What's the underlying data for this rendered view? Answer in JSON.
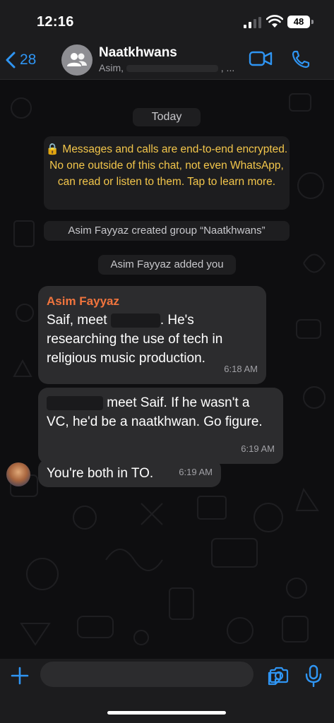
{
  "status_bar": {
    "time": "12:16",
    "battery": "48"
  },
  "header": {
    "back_count": "28",
    "title": "Naatkhwans",
    "subtitle_start": "Asim,",
    "subtitle_end": ", ..."
  },
  "chat": {
    "date_label": "Today",
    "encryption_notice": "🔒 Messages and calls are end-to-end encrypted. No one outside of this chat, not even WhatsApp, can read or listen to them. Tap to learn more.",
    "system_1": "Asim Fayyaz created group “Naatkhwans”",
    "system_2": "Asim Fayyaz added you",
    "messages": [
      {
        "sender": "Asim Fayyaz",
        "text_a": "Saif, meet ",
        "text_b": ". He's researching the use of tech in religious music production.",
        "time": "6:18 AM"
      },
      {
        "text": " meet Saif. If he wasn't a VC, he'd be a naatkhwan. Go figure.",
        "time": "6:19 AM"
      },
      {
        "text": "You're both in TO.",
        "time": "6:19 AM"
      }
    ]
  },
  "colors": {
    "accent": "#2f95f3",
    "sender": "#f0743d",
    "encryption": "#f3c64b"
  }
}
